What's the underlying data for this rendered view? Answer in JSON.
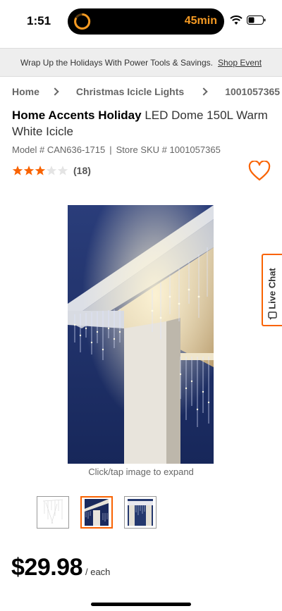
{
  "status_bar": {
    "time": "1:51",
    "timer": "45min"
  },
  "promo": {
    "text": "Wrap Up the Holidays With Power Tools & Savings.",
    "link": "Shop Event"
  },
  "breadcrumb": {
    "home": "Home",
    "category": "Christmas Icicle Lights",
    "sku": "1001057365"
  },
  "product": {
    "brand": "Home Accents Holiday",
    "name": " LED Dome 150L Warm White Icicle",
    "model_label": "Model # CAN636-1715",
    "sku_label": "Store SKU # 1001057365",
    "rating": 3,
    "rating_max": 5,
    "review_count": "(18)"
  },
  "image": {
    "caption": "Click/tap image to expand"
  },
  "thumbnails": {
    "selected_index": 1,
    "count": 3
  },
  "live_chat": {
    "label": "Live Chat"
  },
  "price": {
    "amount": "$29.98",
    "unit": "/ each"
  },
  "colors": {
    "accent": "#f96302",
    "star": "#f96302",
    "night_sky": "#1a2a5e"
  },
  "icons": [
    "timer-ring-icon",
    "wifi-icon",
    "battery-icon",
    "chevron-right-icon",
    "star-icon",
    "heart-icon",
    "chat-icon"
  ]
}
